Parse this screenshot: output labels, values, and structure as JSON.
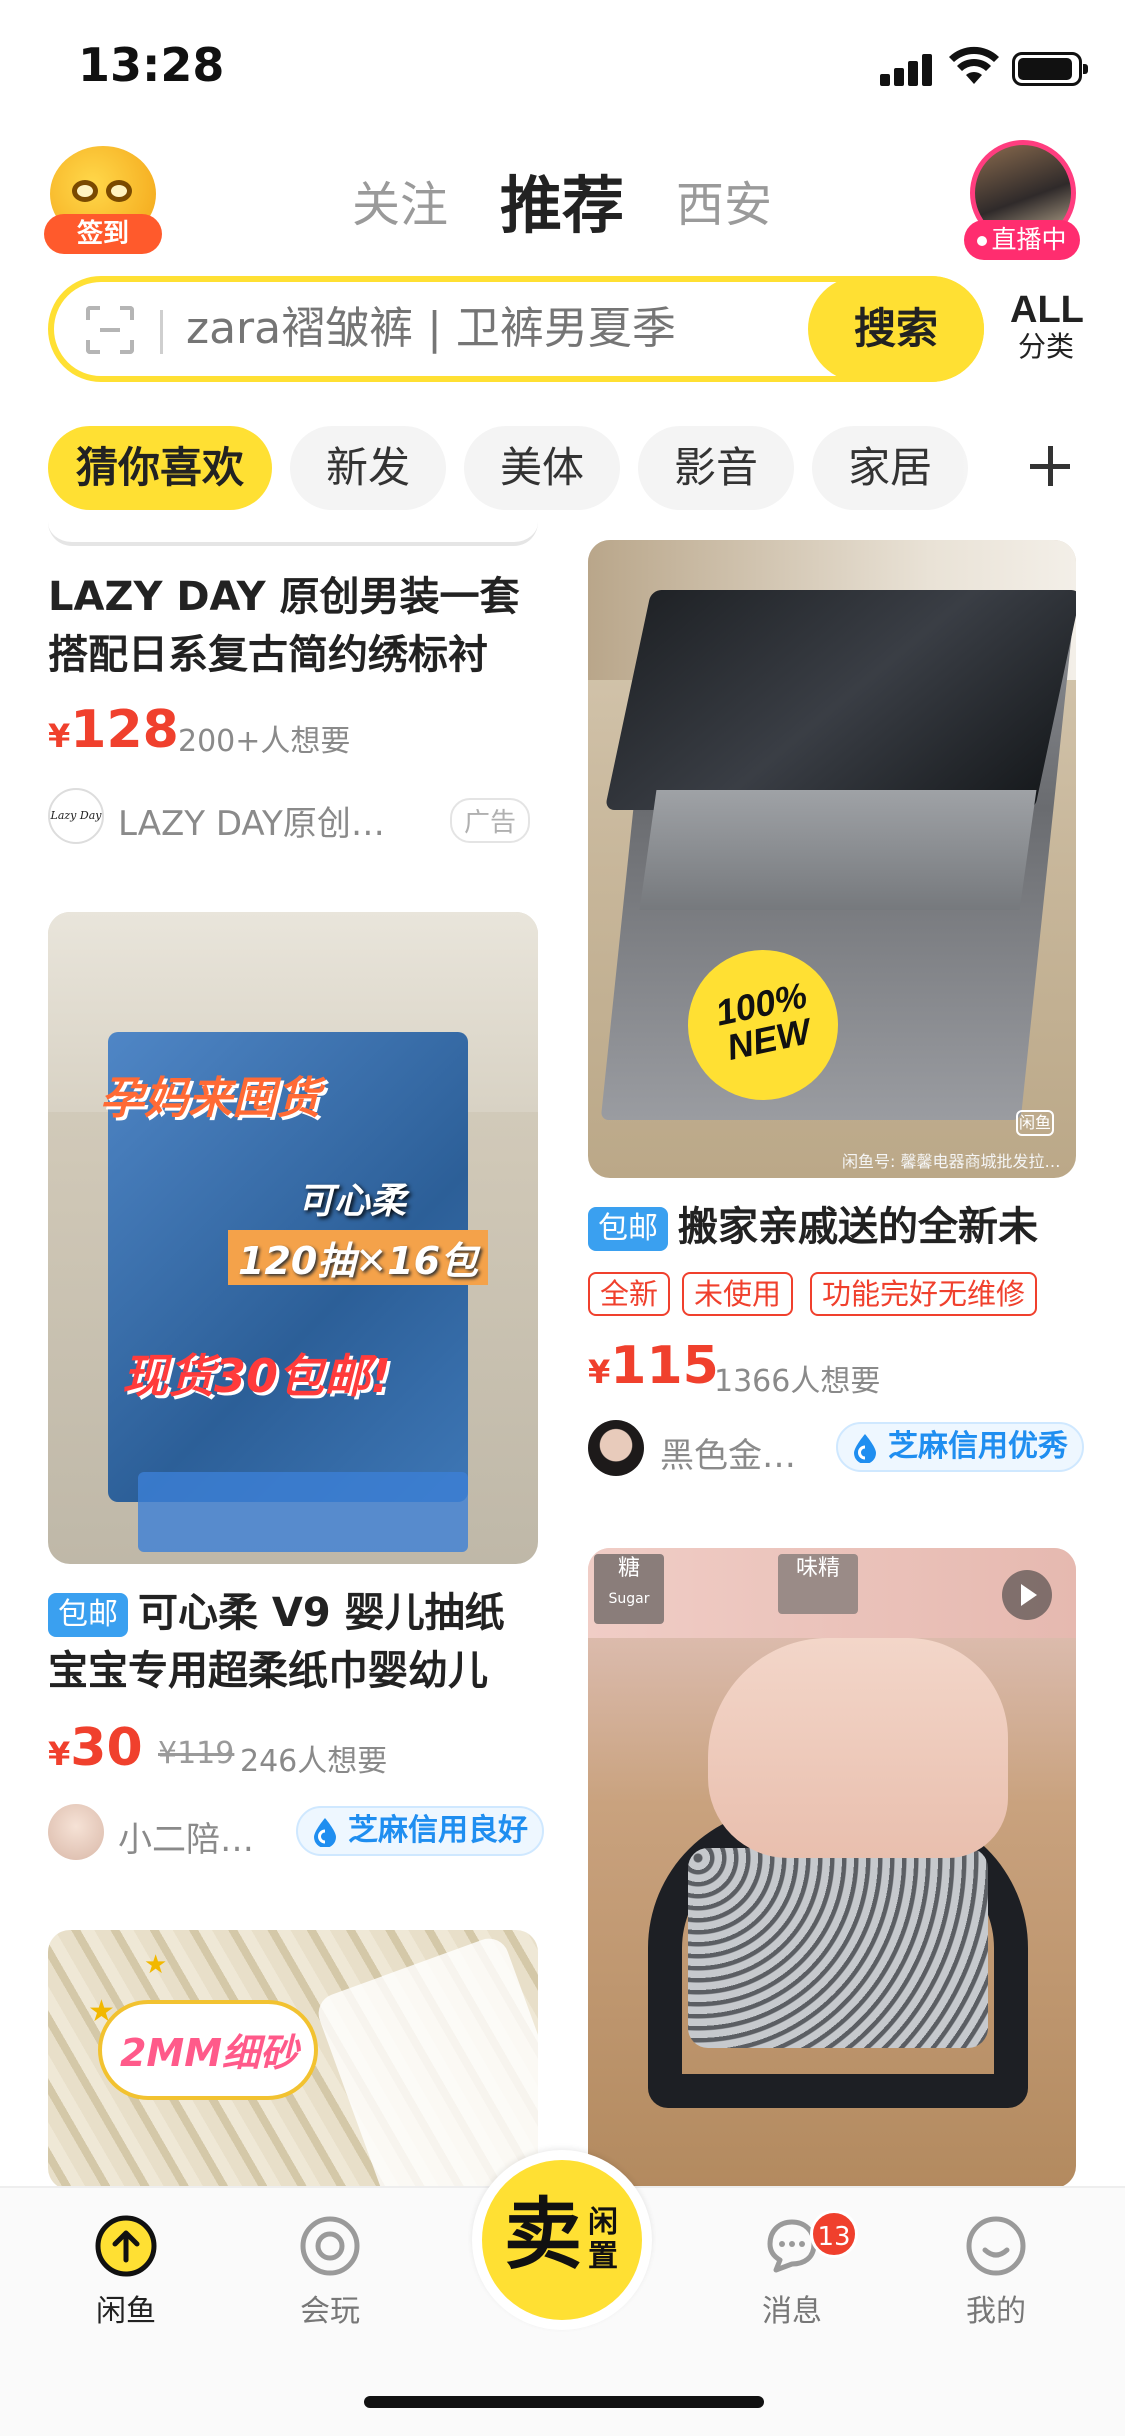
{
  "status_bar": {
    "time": "13:28"
  },
  "header": {
    "signin_label": "签到",
    "tabs": [
      {
        "label": "关注",
        "active": false
      },
      {
        "label": "推荐",
        "active": true
      },
      {
        "label": "西安",
        "active": false
      }
    ],
    "live_label": "直播中"
  },
  "search": {
    "placeholder": "zara褶皱裤 | 卫裤男夏季",
    "button_label": "搜索",
    "all_category_top": "ALL",
    "all_category_bottom": "分类"
  },
  "categories": [
    {
      "label": "猜你喜欢",
      "active": true
    },
    {
      "label": "新发",
      "active": false
    },
    {
      "label": "美体",
      "active": false
    },
    {
      "label": "影音",
      "active": false
    },
    {
      "label": "家居",
      "active": false
    }
  ],
  "feed": {
    "left": [
      {
        "title": "LAZY DAY 原创男装一套搭配日系复古简约绣标衬",
        "title_line1": "LAZY DAY 原创男装一套",
        "title_line2": "搭配日系复古简约绣标衬",
        "currency": "¥",
        "price": "128",
        "want": "200+人想要",
        "seller": "LAZY DAY原创…",
        "avatar_text": "Lazy Day",
        "ad_label": "广告"
      },
      {
        "image_text_1": "孕妈来囤货",
        "image_text_2": "可心柔",
        "image_text_3": "120抽✕16包",
        "image_text_4": "现货30包邮!",
        "badge": "包邮",
        "title_line1": "可心柔 V9 婴儿抽纸",
        "title_line2": "宝宝专用超柔纸巾婴幼儿",
        "currency": "¥",
        "price": "30",
        "original_price": "¥119",
        "want": "246人想要",
        "seller": "小二陪…",
        "credit": "芝麻信用良好"
      },
      {
        "image_text": "2MM细砂"
      }
    ],
    "right": [
      {
        "image_badge": "100% NEW",
        "watermark": "闲鱼号: 馨馨电器商城批发拉…",
        "watermark_logo": "闲鱼",
        "badge": "包邮",
        "title": "搬家亲戚送的全新未",
        "tags": [
          "全新",
          "未使用",
          "功能完好无维修"
        ],
        "currency": "¥",
        "price": "115",
        "want": "1366人想要",
        "seller": "黑色金…",
        "credit": "芝麻信用优秀"
      },
      {
        "image_text_1": "糖",
        "image_text_2": "Sugar",
        "image_text_3": "味精"
      }
    ]
  },
  "bottom_nav": {
    "items": [
      {
        "label": "闲鱼",
        "active": true
      },
      {
        "label": "会玩",
        "active": false
      },
      {
        "label": "消息",
        "active": false,
        "badge": "13"
      },
      {
        "label": "我的",
        "active": false
      }
    ],
    "sell_big": "卖",
    "sell_small": "闲置"
  },
  "colors": {
    "accent_yellow": "#ffe033",
    "price_red": "#f0402d",
    "credit_blue": "#1f8ef0",
    "live_pink": "#ff2d6f"
  }
}
